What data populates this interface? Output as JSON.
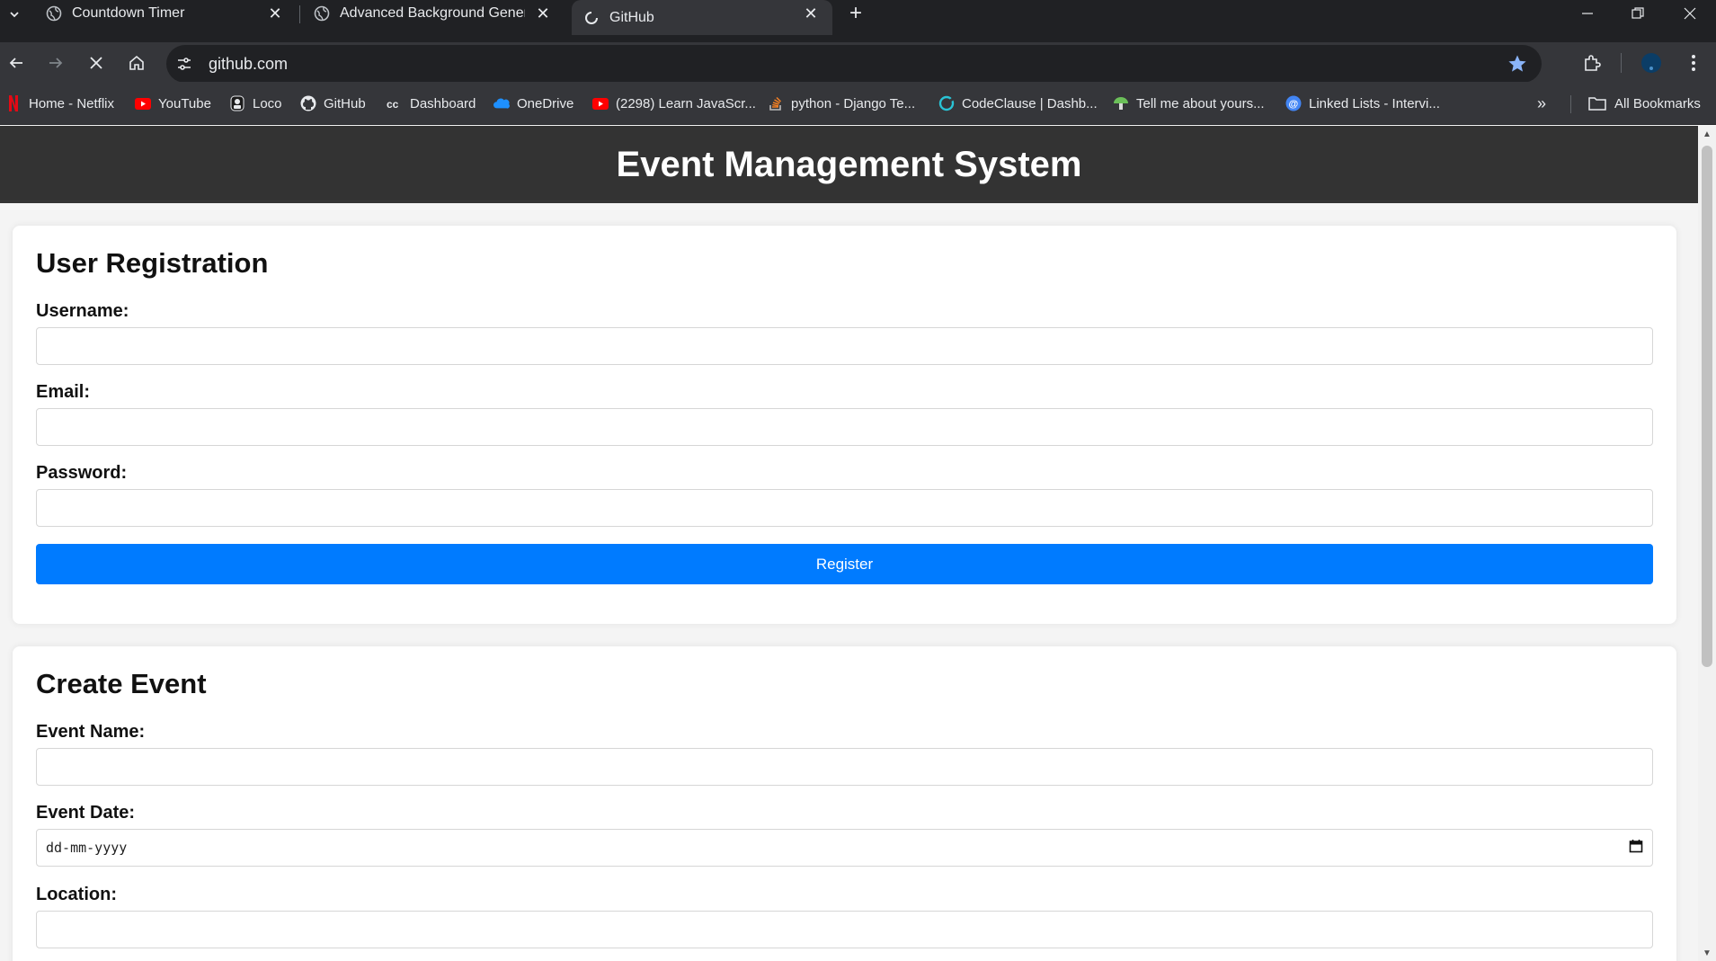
{
  "browser": {
    "tabs": [
      {
        "title": "Countdown Timer",
        "icon": "globe-icon"
      },
      {
        "title": "Advanced Background Generator",
        "icon": "globe-icon"
      },
      {
        "title": "GitHub",
        "icon": "github-icon",
        "active": true
      }
    ],
    "address": {
      "url": "github.com"
    },
    "bookmarks": [
      {
        "label": "Home - Netflix",
        "icon": "netflix-icon"
      },
      {
        "label": "YouTube",
        "icon": "youtube-icon"
      },
      {
        "label": "Loco",
        "icon": "loco-icon"
      },
      {
        "label": "GitHub",
        "icon": "github-icon"
      },
      {
        "label": "Dashboard",
        "icon": "codeclause-icon"
      },
      {
        "label": "OneDrive",
        "icon": "onedrive-icon"
      },
      {
        "label": "(2298) Learn JavaScr...",
        "icon": "youtube-icon"
      },
      {
        "label": "python - Django Te...",
        "icon": "stackoverflow-icon"
      },
      {
        "label": "CodeClause | Dashb...",
        "icon": "codeclause-icon"
      },
      {
        "label": "Tell me about yours...",
        "icon": "mushroom-icon"
      },
      {
        "label": "Linked Lists - Intervi...",
        "icon": "at-icon"
      }
    ],
    "all_bookmarks_label": "All Bookmarks"
  },
  "page": {
    "header_title": "Event Management System",
    "registration": {
      "title": "User Registration",
      "username_label": "Username:",
      "email_label": "Email:",
      "password_label": "Password:",
      "register_button": "Register"
    },
    "create_event": {
      "title": "Create Event",
      "event_name_label": "Event Name:",
      "event_date_label": "Event Date:",
      "event_date_placeholder": "dd-mm-yyyy",
      "location_label": "Location:"
    }
  },
  "colors": {
    "header_bg": "#333333",
    "primary_button": "#007bff",
    "page_bg": "#f4f4f4",
    "browser_bg": "#202124",
    "toolbar_bg": "#35363a"
  }
}
